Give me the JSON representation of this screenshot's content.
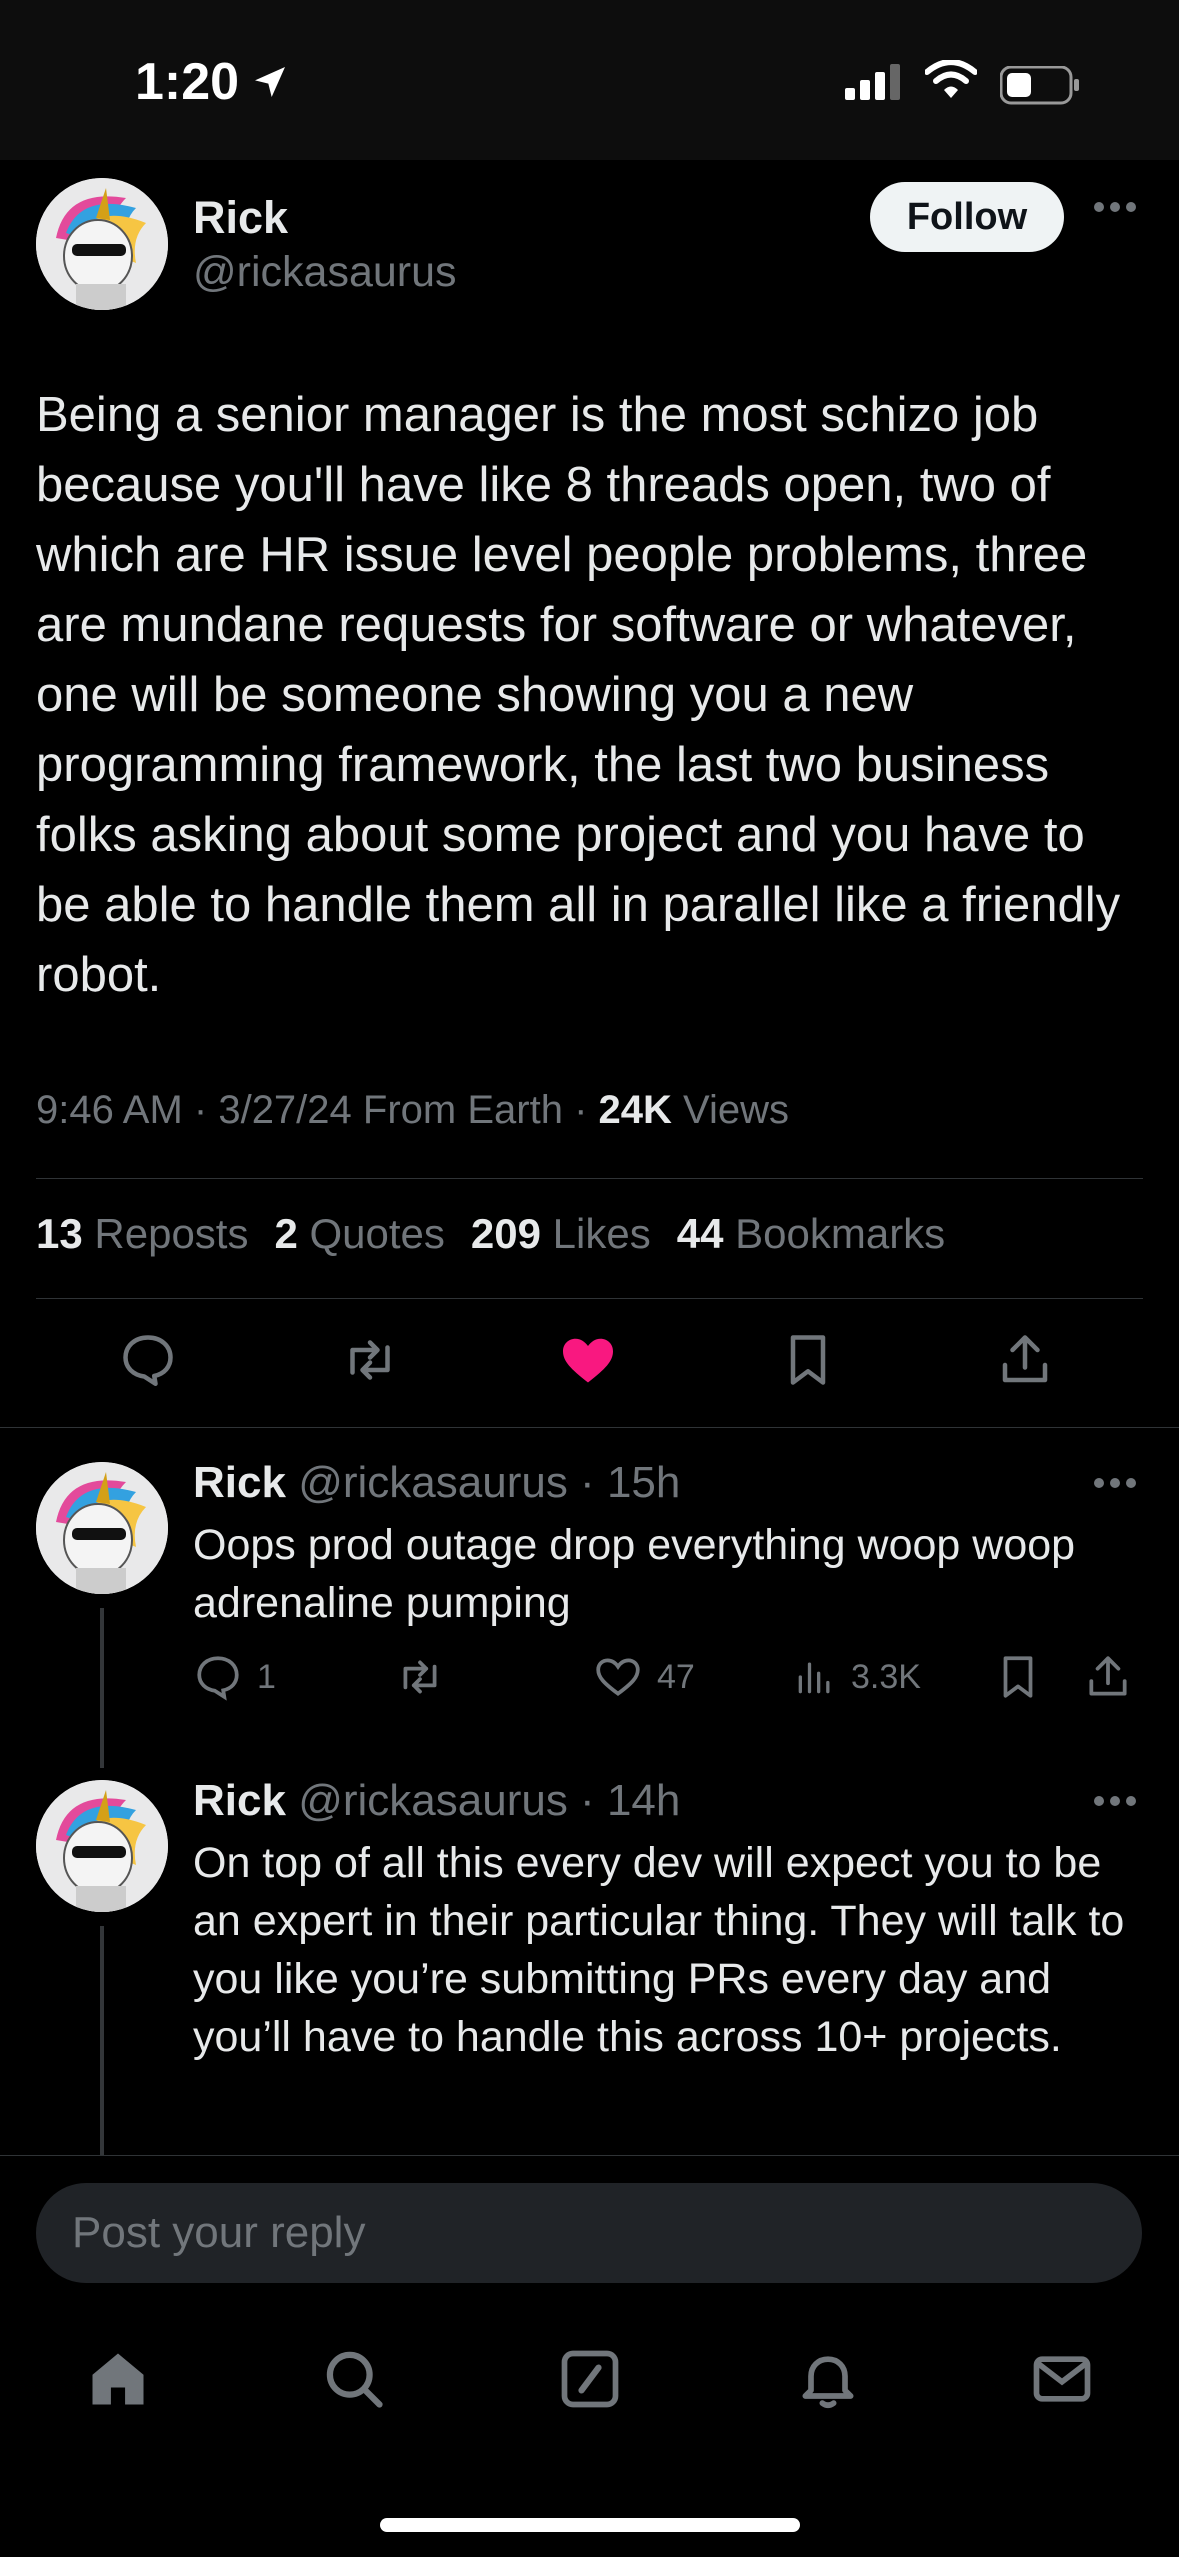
{
  "status_bar": {
    "time": "1:20"
  },
  "tweet": {
    "author_name": "Rick",
    "author_handle": "@rickasaurus",
    "follow_label": "Follow",
    "text": "Being a senior manager is the most schizo job because you'll have like 8 threads open, two of which are HR issue level people problems, three are mundane requests for software or whatever, one will be someone showing you a new programming framework, the last two business folks asking about some project and you have to be able to handle them all in parallel like a friendly robot.",
    "time": "9:46 AM",
    "date": "3/27/24",
    "source": "From Earth",
    "views_count": "24K",
    "views_label": "Views",
    "stats": {
      "reposts_count": "13",
      "reposts_label": "Reposts",
      "quotes_count": "2",
      "quotes_label": "Quotes",
      "likes_count": "209",
      "likes_label": "Likes",
      "bookmarks_count": "44",
      "bookmarks_label": "Bookmarks"
    },
    "liked": true,
    "like_color": "#f91880"
  },
  "replies": [
    {
      "name": "Rick",
      "handle": "@rickasaurus",
      "age": "15h",
      "text": "Oops prod outage drop everything woop woop adrenaline pumping",
      "reply_count": "1",
      "repost_count": "",
      "like_count": "47",
      "view_count": "3.3K"
    },
    {
      "name": "Rick",
      "handle": "@rickasaurus",
      "age": "14h",
      "text": "On top of all this every dev will expect you to be an expert in their particular thing. They will talk to you like you’re submitting PRs every day and you’ll have to handle this across 10+ projects."
    }
  ],
  "composer": {
    "placeholder": "Post your reply"
  },
  "bottom_nav": [
    "home-icon",
    "search-icon",
    "compose-icon",
    "notifications-icon",
    "messages-icon"
  ],
  "colors": {
    "background": "#000000",
    "text": "#e7e9ea",
    "secondary": "#71767b",
    "like": "#f91880"
  }
}
